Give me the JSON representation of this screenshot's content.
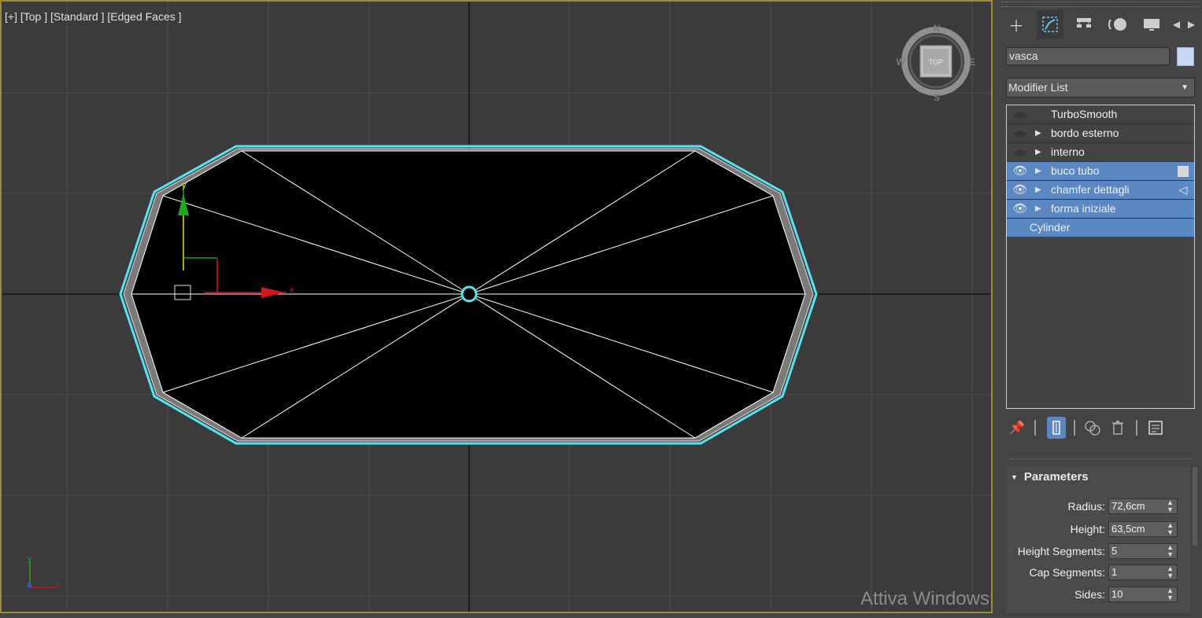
{
  "viewport": {
    "label": "[+] [Top ] [Standard ] [Edged Faces ]",
    "viewcube": {
      "face": "TOP",
      "north": "N",
      "south": "S",
      "east": "E",
      "west": "W"
    },
    "gizmo": {
      "x": "x",
      "y": "y"
    },
    "corner_axes": {
      "x": "x",
      "y": "y"
    },
    "watermark": "Attiva Windows"
  },
  "panel": {
    "tabs": [
      {
        "name": "create",
        "icon": "plus-icon"
      },
      {
        "name": "modify",
        "icon": "modify-icon",
        "active": true
      },
      {
        "name": "hierarchy",
        "icon": "hierarchy-icon"
      },
      {
        "name": "motion",
        "icon": "motion-icon"
      },
      {
        "name": "display",
        "icon": "display-icon"
      },
      {
        "name": "prev",
        "icon": "arrow-left-icon"
      },
      {
        "name": "next",
        "icon": "arrow-right-icon"
      }
    ],
    "object_name": "vasca",
    "object_color": "#c6d8f6",
    "modifier_list": "Modifier List",
    "stack": [
      {
        "label": "TurboSmooth",
        "visible": false,
        "expandable": false,
        "selected": false
      },
      {
        "label": "bordo esterno",
        "visible": false,
        "expandable": true,
        "selected": false
      },
      {
        "label": "interno",
        "visible": false,
        "expandable": true,
        "selected": false
      },
      {
        "label": "buco tubo",
        "visible": true,
        "expandable": true,
        "selected": true,
        "extra": "box"
      },
      {
        "label": "chamfer dettagli",
        "visible": true,
        "expandable": true,
        "selected": true,
        "extra": "triangle"
      },
      {
        "label": "forma iniziale",
        "visible": true,
        "expandable": true,
        "selected": true
      },
      {
        "label": "Cylinder",
        "base": true,
        "selected": true
      }
    ],
    "parameters": {
      "title": "Parameters",
      "fields": [
        {
          "label": "Radius:",
          "value": "72,6cm"
        },
        {
          "label": "Height:",
          "value": "63,5cm"
        },
        {
          "label": "Height Segments:",
          "value": "5"
        },
        {
          "label": "Cap Segments:",
          "value": "1"
        },
        {
          "label": "Sides:",
          "value": "10"
        }
      ]
    }
  },
  "colors": {
    "selection": "#5b87c2",
    "highlight": "#54e4f0",
    "viewport_border": "#a08a3c"
  }
}
